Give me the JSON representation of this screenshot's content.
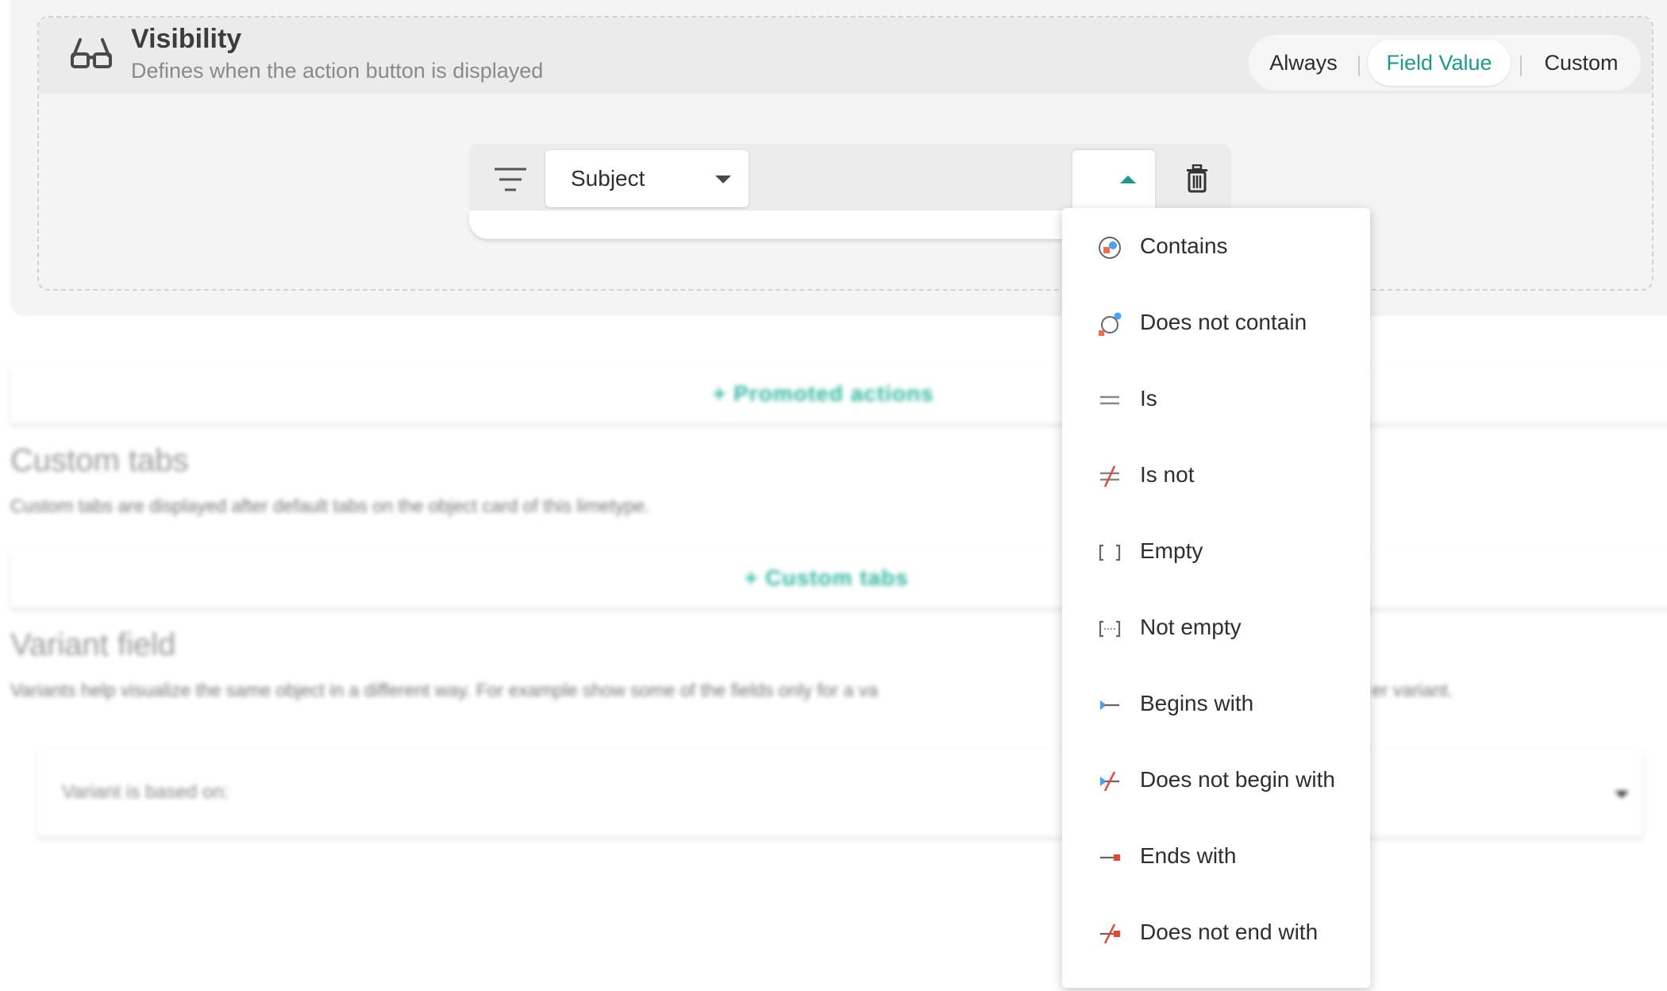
{
  "visibility": {
    "title": "Visibility",
    "subtitle": "Defines when the action button is displayed",
    "icon": "glasses-icon",
    "modes": [
      {
        "label": "Always"
      },
      {
        "label": "Field Value"
      },
      {
        "label": "Custom"
      }
    ],
    "selected_mode": "Field Value",
    "accent_color": "#1e9a88"
  },
  "filter": {
    "field": "Subject",
    "operator_value": "",
    "filter_icon": "filter-lines-icon",
    "delete_icon": "trash-icon"
  },
  "background": {
    "promoted_actions_label": "+ Promoted actions",
    "custom_tabs_title": "Custom tabs",
    "custom_tabs_desc": "Custom tabs are displayed after default tabs on the object card of this limetype.",
    "custom_tabs_label": "+ Custom tabs",
    "variant_title": "Variant field",
    "variant_desc": "Variants help visualize the same object in a different way. For example show some of the fields only for a va",
    "variant_desc_tail": "er variant.",
    "variant_label": "Variant is based on:"
  },
  "operator_menu": {
    "items": [
      {
        "label": "Contains",
        "icon": "contains-icon"
      },
      {
        "label": "Does not contain",
        "icon": "does-not-contain-icon"
      },
      {
        "label": "Is",
        "icon": "equals-icon"
      },
      {
        "label": "Is not",
        "icon": "not-equals-icon"
      },
      {
        "label": "Empty",
        "icon": "empty-brackets-icon"
      },
      {
        "label": "Not empty",
        "icon": "not-empty-brackets-icon"
      },
      {
        "label": "Begins with",
        "icon": "begins-with-icon"
      },
      {
        "label": "Does not begin with",
        "icon": "does-not-begin-with-icon"
      },
      {
        "label": "Ends with",
        "icon": "ends-with-icon"
      },
      {
        "label": "Does not end with",
        "icon": "does-not-end-with-icon"
      }
    ]
  }
}
